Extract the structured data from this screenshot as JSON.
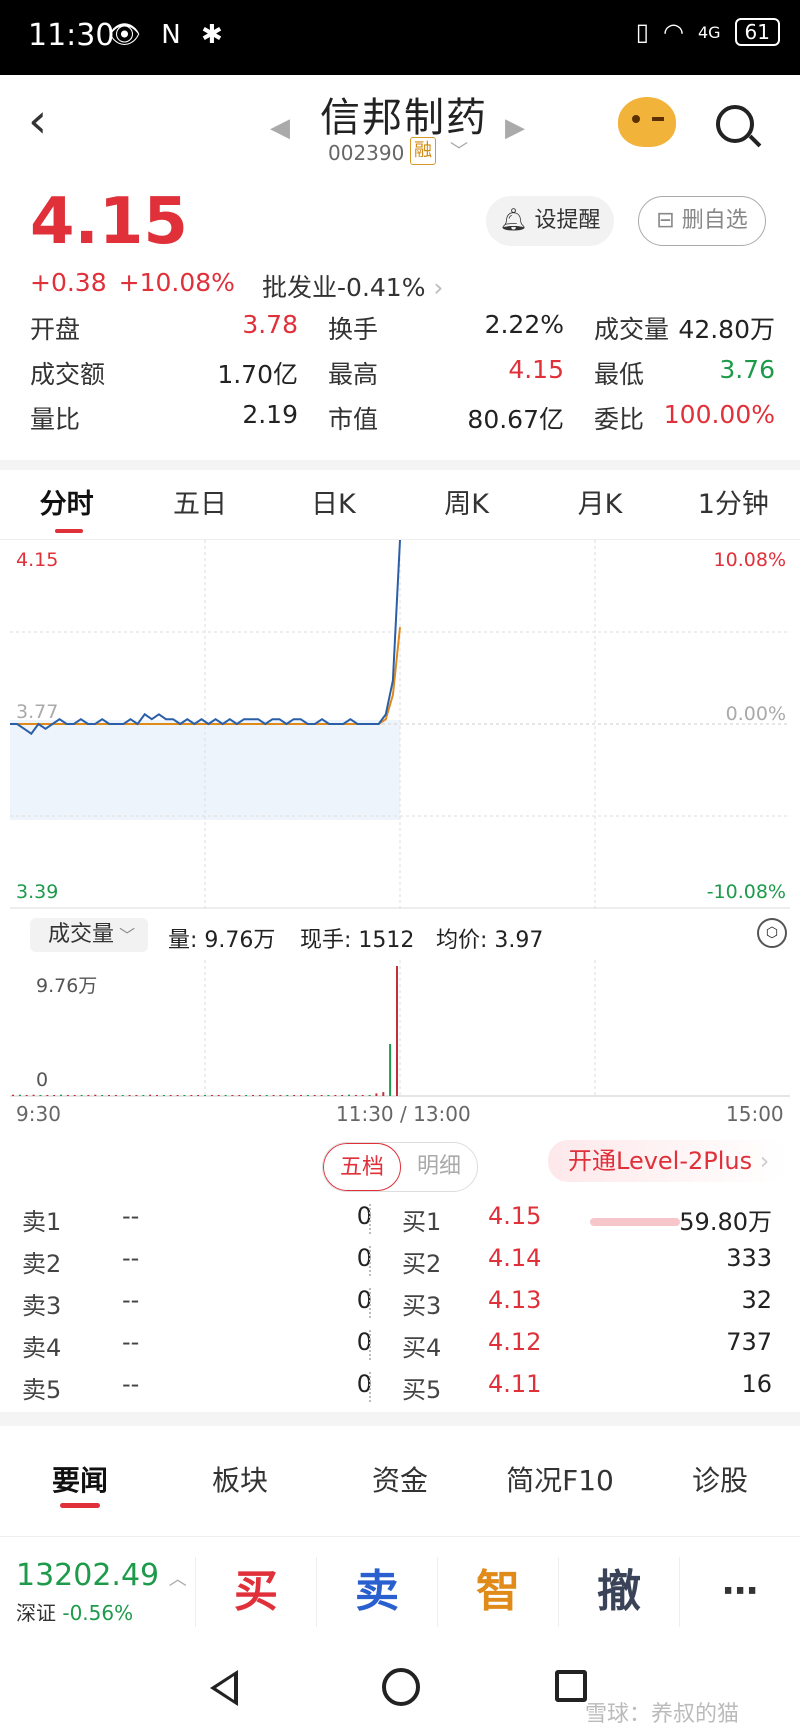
{
  "status_bar": {
    "time": "11:30",
    "icons": "👁 N ✱",
    "signal": "4G",
    "battery": "61"
  },
  "header": {
    "stock_name": "信邦制药",
    "code": "002390",
    "rong_badge": "融"
  },
  "quote": {
    "price": "4.15",
    "change": "+0.38",
    "change_pct": "+10.08%",
    "industry_label": "批发业",
    "industry_change": "-0.41%",
    "remind_button": "设提醒",
    "remove_button": "删自选"
  },
  "stats": [
    [
      {
        "label": "开盘",
        "value": "3.78",
        "color": "red"
      },
      {
        "label": "换手",
        "value": "2.22%",
        "color": "dark"
      },
      {
        "label": "成交量",
        "value": "42.80万",
        "color": "dark"
      }
    ],
    [
      {
        "label": "成交额",
        "value": "1.70亿",
        "color": "dark"
      },
      {
        "label": "最高",
        "value": "4.15",
        "color": "red"
      },
      {
        "label": "最低",
        "value": "3.76",
        "color": "green"
      }
    ],
    [
      {
        "label": "量比",
        "value": "2.19",
        "color": "dark"
      },
      {
        "label": "市值",
        "value": "80.67亿",
        "color": "dark"
      },
      {
        "label": "委比",
        "value": "100.00%",
        "color": "red"
      }
    ]
  ],
  "chart_tabs": [
    "分时",
    "五日",
    "日K",
    "周K",
    "月K",
    "1分钟"
  ],
  "chart_data": {
    "type": "line",
    "y_left_top": "4.15",
    "y_left_mid": "3.77",
    "y_left_bottom": "3.39",
    "y_right_top": "10.08%",
    "y_right_mid": "0.00%",
    "y_right_bottom": "-10.08%",
    "ylim": [
      3.39,
      4.15
    ],
    "time_labels": [
      "9:30",
      "11:30 / 13:00",
      "15:00"
    ],
    "price_series": [
      3.77,
      3.77,
      3.76,
      3.75,
      3.77,
      3.76,
      3.77,
      3.78,
      3.77,
      3.77,
      3.78,
      3.77,
      3.77,
      3.78,
      3.77,
      3.77,
      3.77,
      3.78,
      3.77,
      3.79,
      3.78,
      3.79,
      3.78,
      3.78,
      3.77,
      3.78,
      3.77,
      3.78,
      3.77,
      3.78,
      3.77,
      3.78,
      3.77,
      3.78,
      3.78,
      3.78,
      3.77,
      3.78,
      3.78,
      3.77,
      3.78,
      3.78,
      3.77,
      3.77,
      3.78,
      3.77,
      3.77,
      3.77,
      3.78,
      3.77,
      3.77,
      3.77,
      3.77,
      3.79,
      3.86,
      4.15
    ],
    "avg_series": [
      3.77,
      3.77,
      3.77,
      3.77,
      3.77,
      3.77,
      3.77,
      3.77,
      3.77,
      3.77,
      3.77,
      3.77,
      3.77,
      3.77,
      3.77,
      3.77,
      3.77,
      3.77,
      3.77,
      3.77,
      3.77,
      3.77,
      3.77,
      3.77,
      3.77,
      3.77,
      3.77,
      3.77,
      3.77,
      3.77,
      3.77,
      3.77,
      3.77,
      3.77,
      3.77,
      3.77,
      3.77,
      3.77,
      3.77,
      3.77,
      3.77,
      3.77,
      3.77,
      3.77,
      3.77,
      3.77,
      3.77,
      3.77,
      3.77,
      3.77,
      3.77,
      3.77,
      3.77,
      3.78,
      3.83,
      3.97
    ],
    "volume_max_label": "9.76万",
    "volume_zero_label": "0",
    "volume_series": [
      1,
      1,
      0.5,
      1,
      0.3,
      0.5,
      0.3,
      1,
      0.3,
      0.5,
      0.3,
      0.5,
      1,
      0.3,
      0.5,
      0.3,
      0.5,
      0.3,
      0.5,
      0.3,
      1,
      0.3,
      0.5,
      0.3,
      0.5,
      0.3,
      0.5,
      0.3,
      0.5,
      0.3,
      0.5,
      0.3,
      0.5,
      0.3,
      0.5,
      0.3,
      0.5,
      0.3,
      0.5,
      0.3,
      0.5,
      0.3,
      0.5,
      0.3,
      0.5,
      0.3,
      0.5,
      0.3,
      0.5,
      1,
      0.3,
      0.5,
      0.3,
      2,
      3,
      40,
      100
    ]
  },
  "volume_bar": {
    "selector": "成交量",
    "vol_label": "量: 9.76万",
    "now_label": "现手: 1512",
    "avg_label": "均价: 3.97"
  },
  "orderbook_tabs": {
    "active": "五档",
    "inactive": "明细",
    "level2": "开通Level-2Plus"
  },
  "orderbook": {
    "sell": [
      {
        "label": "卖1",
        "price": "--",
        "qty": "0"
      },
      {
        "label": "卖2",
        "price": "--",
        "qty": "0"
      },
      {
        "label": "卖3",
        "price": "--",
        "qty": "0"
      },
      {
        "label": "卖4",
        "price": "--",
        "qty": "0"
      },
      {
        "label": "卖5",
        "price": "--",
        "qty": "0"
      }
    ],
    "buy": [
      {
        "label": "买1",
        "price": "4.15",
        "qty": "59.80万",
        "bar": 1.0
      },
      {
        "label": "买2",
        "price": "4.14",
        "qty": "333",
        "bar": 0
      },
      {
        "label": "买3",
        "price": "4.13",
        "qty": "32",
        "bar": 0
      },
      {
        "label": "买4",
        "price": "4.12",
        "qty": "737",
        "bar": 0
      },
      {
        "label": "买5",
        "price": "4.11",
        "qty": "16",
        "bar": 0
      }
    ]
  },
  "news_tabs": [
    "要闻",
    "板块",
    "资金",
    "简况F10",
    "诊股"
  ],
  "bottom": {
    "index_value": "13202.49",
    "index_name": "深证",
    "index_change": "-0.56%",
    "buy": "买",
    "sell": "卖",
    "smart": "智",
    "cancel": "撤",
    "more": "⋯"
  },
  "watermark": "雪球：养叔的猫"
}
